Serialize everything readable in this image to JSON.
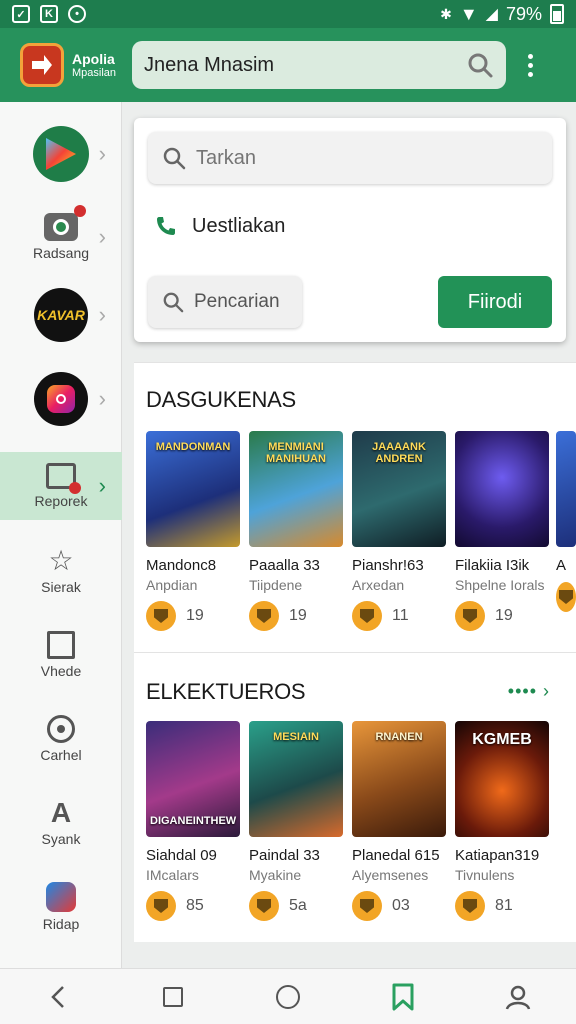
{
  "status": {
    "battery_text": "79%",
    "left_icons": [
      "check-square-icon",
      "k-square-icon",
      "dots-circle-icon"
    ]
  },
  "appbar": {
    "brand_line1": "Apolia",
    "brand_line2": "Mpasilan",
    "search_value": "Jnena Mnasim"
  },
  "rail": {
    "items": [
      {
        "label": "",
        "icon": "play-store-icon"
      },
      {
        "label": "Radsang",
        "icon": "camera-icon"
      },
      {
        "label": "",
        "icon": "kavar-logo-icon"
      },
      {
        "label": "",
        "icon": "instagram-icon"
      },
      {
        "label": "Reporek",
        "icon": "report-icon"
      },
      {
        "label": "Sierak",
        "icon": "star-icon"
      },
      {
        "label": "Vhede",
        "icon": "crop-icon"
      },
      {
        "label": "Carhel",
        "icon": "target-icon"
      },
      {
        "label": "Syank",
        "icon": "a-logo-icon"
      },
      {
        "label": "Ridap",
        "icon": "shop-icon"
      }
    ]
  },
  "card": {
    "field_placeholder": "Tarkan",
    "phone_label": "Uestliakan",
    "search_button": "Pencarian",
    "green_button": "Fiirodi"
  },
  "section1": {
    "title": "DASGUKENAS",
    "tiles": [
      {
        "thumb_text": "MANDONMAN",
        "name": "Mandonc8",
        "sub": "Anpdian",
        "score": "19"
      },
      {
        "thumb_text": "MENMIANI MANIHUAN",
        "name": "Paaalla 33",
        "sub": "Tiipdene",
        "score": "19"
      },
      {
        "thumb_text": "JAAAANK ANDREN",
        "name": "Pianshr!63",
        "sub": "Arxedan",
        "score": "11"
      },
      {
        "thumb_text": "",
        "name": "Filakiia I3ik",
        "sub": "Shpelne Iorals",
        "score": "19"
      },
      {
        "thumb_text": "",
        "name": "A",
        "sub": "",
        "score": ""
      }
    ]
  },
  "section2": {
    "title": "ELKEKTUEROS",
    "more": "•••• ›",
    "tiles": [
      {
        "thumb_text": "DIGANEINTHEW",
        "name": "Siahdal 09",
        "sub": "IMcalars",
        "score": "85"
      },
      {
        "thumb_text": "MESIAIN",
        "name": "Paindal 33",
        "sub": "Myakine",
        "score": "5a"
      },
      {
        "thumb_text": "RNANEN",
        "name": "Planedal 615",
        "sub": "Alyemsenes",
        "score": "03"
      },
      {
        "thumb_text": "KGMEB",
        "name": "Katiapan319",
        "sub": "Tivnulens",
        "score": "81"
      }
    ]
  },
  "colors": {
    "brand_green": "#27925c",
    "accent_orange": "#f2a526"
  }
}
